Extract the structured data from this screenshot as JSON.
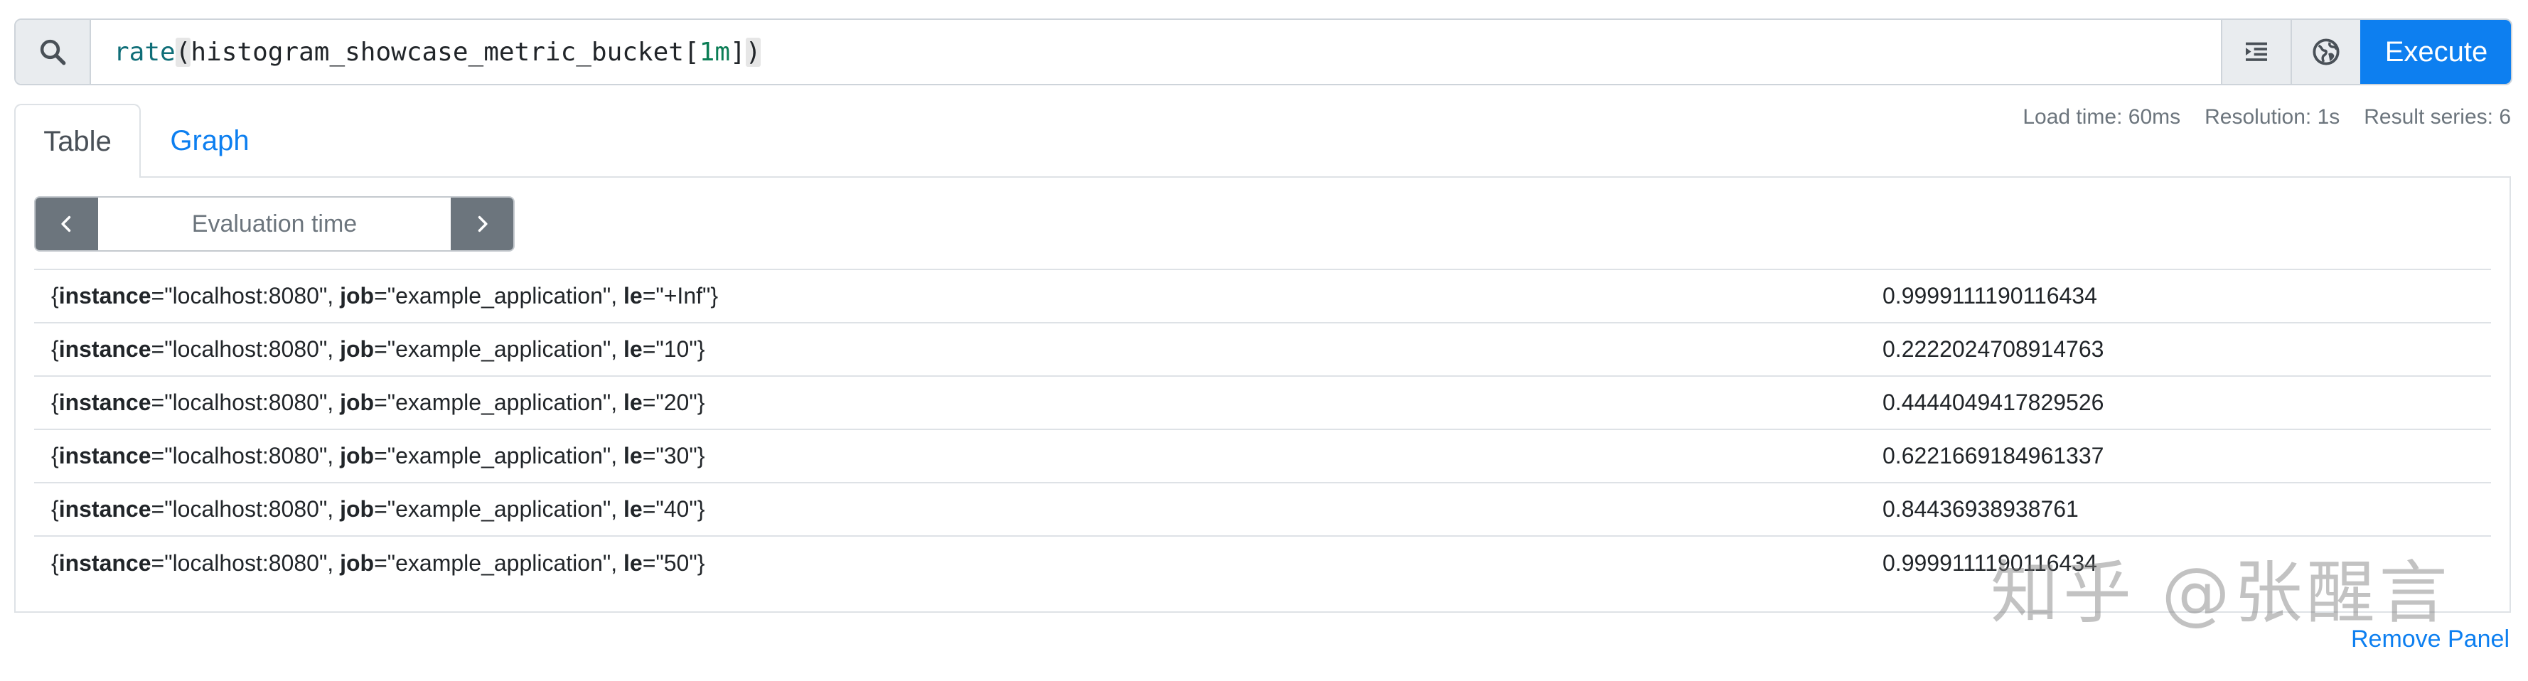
{
  "expression": {
    "parts": [
      {
        "text": "rate",
        "kind": "fn"
      },
      {
        "text": "(",
        "kind": "paren"
      },
      {
        "text": "histogram_showcase_metric_bucket[",
        "kind": "plain"
      },
      {
        "text": "1m",
        "kind": "num"
      },
      {
        "text": "]",
        "kind": "plain"
      },
      {
        "text": ")",
        "kind": "paren"
      }
    ]
  },
  "toolbar": {
    "search_icon": "search-icon",
    "format_icon": "format-indent-icon",
    "metrics_explorer_icon": "globe-icon",
    "execute_label": "Execute"
  },
  "tabs": [
    {
      "label": "Table",
      "active": true
    },
    {
      "label": "Graph",
      "active": false
    }
  ],
  "stats": {
    "load_time": "Load time: 60ms",
    "resolution": "Resolution: 1s",
    "result_series": "Result series: 6"
  },
  "evaluation": {
    "placeholder": "Evaluation time",
    "prev_icon": "chevron-left-icon",
    "next_icon": "chevron-right-icon"
  },
  "results": [
    {
      "instance": "localhost:8080",
      "job": "example_application",
      "le": "+Inf",
      "value": "0.9999111190116434"
    },
    {
      "instance": "localhost:8080",
      "job": "example_application",
      "le": "10",
      "value": "0.2222024708914763"
    },
    {
      "instance": "localhost:8080",
      "job": "example_application",
      "le": "20",
      "value": "0.4444049417829526"
    },
    {
      "instance": "localhost:8080",
      "job": "example_application",
      "le": "30",
      "value": "0.6221669184961337"
    },
    {
      "instance": "localhost:8080",
      "job": "example_application",
      "le": "40",
      "value": "0.84436938938761"
    },
    {
      "instance": "localhost:8080",
      "job": "example_application",
      "le": "50",
      "value": "0.9999111190116434"
    }
  ],
  "label_keys": {
    "instance": "instance",
    "job": "job",
    "le": "le"
  },
  "watermark": "知乎 @张醒言",
  "remove_panel_label": "Remove Panel",
  "colors": {
    "accent": "#0d7ff0",
    "secondary": "#6c757d",
    "border": "#dee2e6"
  }
}
